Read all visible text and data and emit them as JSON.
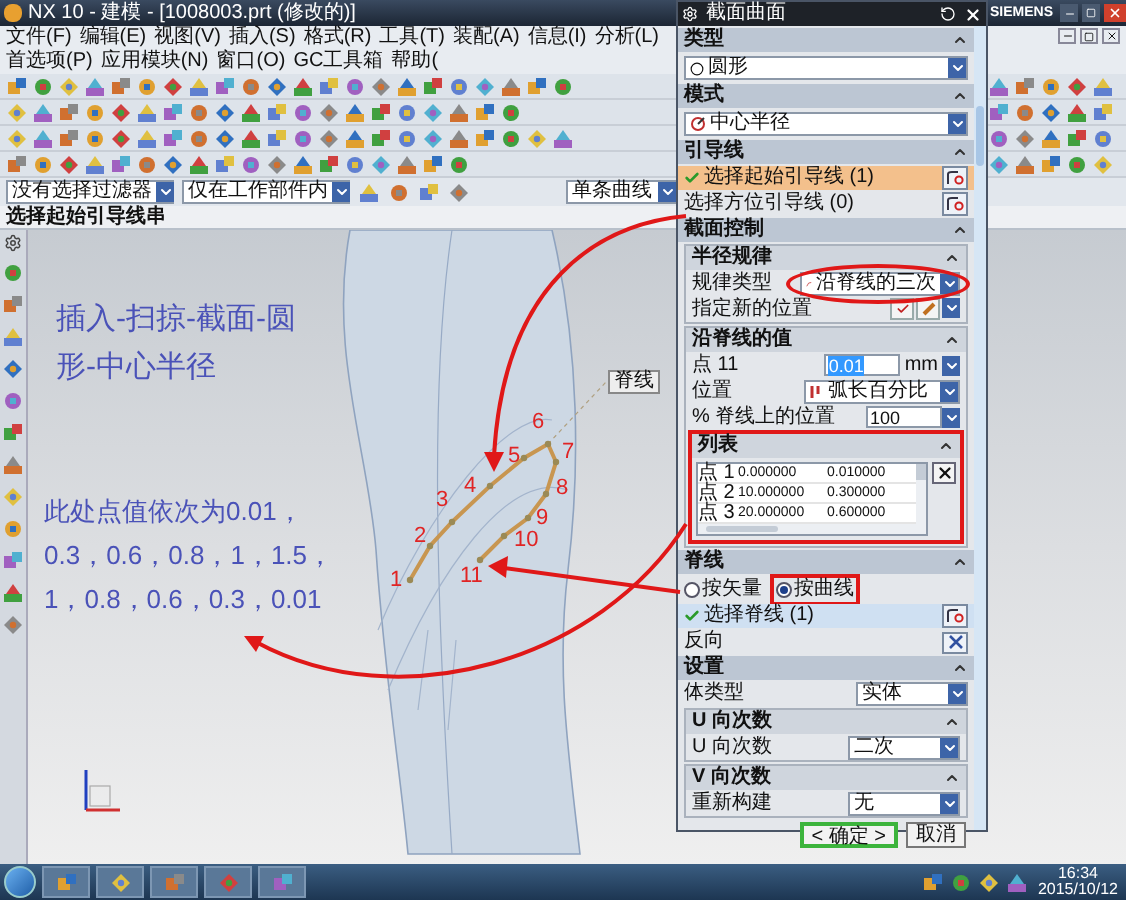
{
  "window": {
    "title": "NX 10 - 建模 - [1008003.prt (修改的)]",
    "brand": "SIEMENS"
  },
  "menu": [
    "文件(F)",
    "编辑(E)",
    "视图(V)",
    "插入(S)",
    "格式(R)",
    "工具(T)",
    "装配(A)",
    "信息(I)",
    "分析(L)",
    "首选项(P)",
    "应用模块(N)",
    "窗口(O)",
    "GC工具箱",
    "帮助("
  ],
  "filter_bar": {
    "type_filter": "没有选择过滤器",
    "scope": "仅在工作部件内",
    "curve_rule": "单条曲线"
  },
  "cue_line": "选择起始引导线串",
  "viewport": {
    "notes": [
      {
        "lines": [
          "插入-扫掠-截面-圆",
          "形-中心半径"
        ]
      },
      {
        "lines": [
          "此处点值依次为0.01，",
          "0.3，0.6，0.8，1，1.5，",
          "1，0.8，0.6，0.3，0.01"
        ]
      }
    ],
    "point_labels": [
      "1",
      "2",
      "3",
      "4",
      "5",
      "6",
      "7",
      "8",
      "9",
      "10",
      "11"
    ],
    "spine_tag": "脊线"
  },
  "dialog": {
    "title": "截面曲面",
    "type": {
      "header": "类型",
      "value": "圆形"
    },
    "mode": {
      "header": "模式",
      "value": "中心半径"
    },
    "guides": {
      "header": "引导线",
      "items": [
        {
          "label": "选择起始引导线 (1)",
          "selected": true,
          "complete": true
        },
        {
          "label": "选择方位引导线 (0)",
          "selected": false,
          "complete": false
        }
      ]
    },
    "section_control": {
      "header": "截面控制",
      "radius_law": {
        "header": "半径规律",
        "law_type_label": "规律类型",
        "law_type": "沿脊线的三次",
        "new_position_label": "指定新的位置"
      },
      "spine_values": {
        "header": "沿脊线的值",
        "point_label": "点 11",
        "point_value": "0.01",
        "unit": "mm",
        "position_label": "位置",
        "position": "弧长百分比",
        "percent_label": "% 脊线上的位置",
        "percent": "100"
      },
      "list": {
        "header": "列表",
        "rows": [
          {
            "cells": [
              "点 1",
              "0.000000",
              "0.010000"
            ]
          },
          {
            "cells": [
              "点 2",
              "10.000000",
              "0.300000"
            ]
          },
          {
            "cells": [
              "点 3",
              "20.000000",
              "0.600000"
            ]
          }
        ]
      }
    },
    "spine": {
      "header": "脊线",
      "options": [
        {
          "label": "按矢量",
          "selected": false
        },
        {
          "label": "按曲线",
          "selected": true
        }
      ],
      "select_label": "选择脊线 (1)",
      "reverse_label": "反向"
    },
    "settings": {
      "header": "设置",
      "body_type_label": "体类型",
      "body_type": "实体",
      "u_degree": {
        "header": "U 向次数",
        "label": "U 向次数",
        "value": "二次"
      },
      "v_degree": {
        "header": "V 向次数",
        "label": "重新构建",
        "value": "无"
      }
    },
    "buttons": [
      {
        "label": "< 确定 >",
        "default": true
      },
      {
        "label": "取消",
        "default": false
      }
    ]
  },
  "taskbar": {
    "time": "16:34",
    "date": "2015/10/12"
  }
}
